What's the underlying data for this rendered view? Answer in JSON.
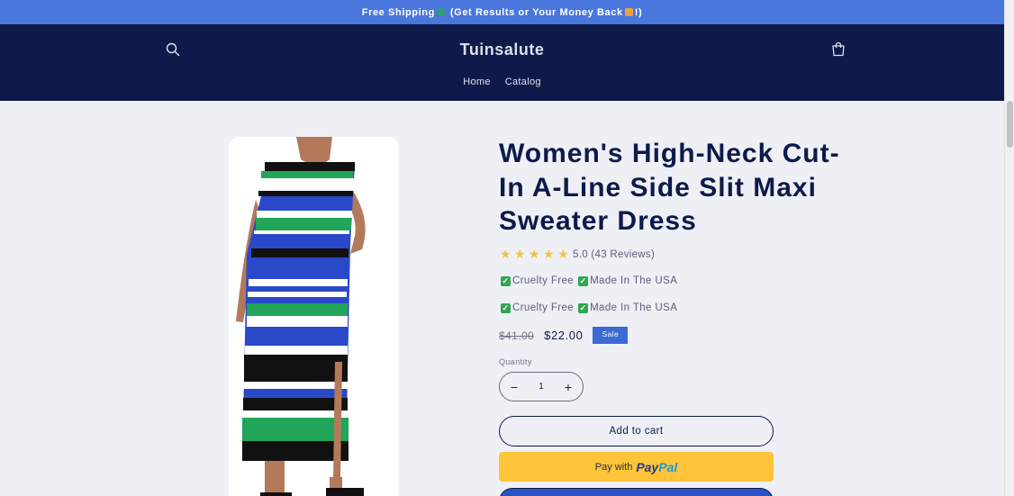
{
  "announcement": {
    "text_before": "Free Shipping",
    "text_middle": "(Get Results or Your Money Back",
    "text_after": "!)"
  },
  "header": {
    "brand": "Tuinsalute",
    "nav": [
      "Home",
      "Catalog"
    ]
  },
  "product": {
    "title": "Women's High-Neck Cut-In A-Line Side Slit Maxi Sweater Dress",
    "rating": {
      "value": 5.0,
      "stars": 5,
      "text": "5.0 (43 Reviews)"
    },
    "badges_row1": [
      "Cruelty Free",
      "Made In The USA"
    ],
    "badges_row2": [
      "Cruelty Free",
      "Made In The USA"
    ],
    "price_old": "$41.00",
    "price_new": "$22.00",
    "sale_label": "Sale",
    "quantity_label": "Quantity",
    "quantity_value": "1",
    "add_to_cart": "Add to cart",
    "paypal": {
      "prefix": "Pay with",
      "brand_part1": "Pay",
      "brand_part2": "Pal"
    }
  },
  "colors": {
    "announcement_bg": "#4a77dd",
    "header_bg": "#0e1a4a",
    "page_bg": "#eef0f6",
    "star": "#f5c33b",
    "sale_badge": "#3b6ad2",
    "paypal_bg": "#ffc439"
  },
  "icons": {
    "search": "search-icon",
    "cart": "cart-icon",
    "check": "checkmark-icon",
    "star": "star-icon"
  }
}
